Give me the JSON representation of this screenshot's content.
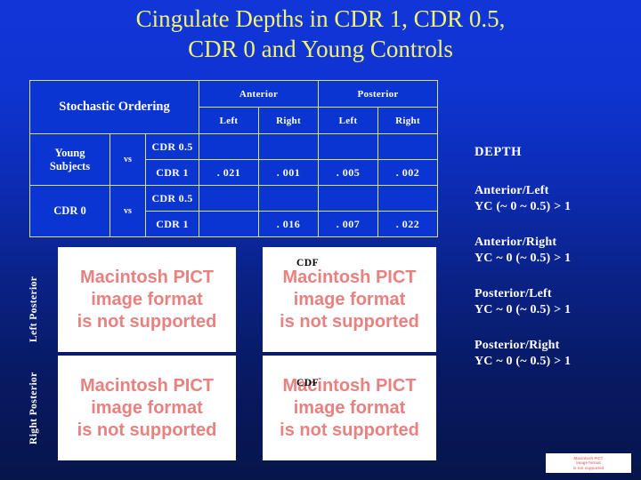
{
  "slide": {
    "title": "Cingulate Depths in CDR 1, CDR 0.5,\nCDR 0 and Young Controls",
    "title_color": "#F2F274",
    "background_top_color": "#1136D8",
    "background_bottom_color": "#06154A"
  },
  "table": {
    "corner_label": "Stochastic Ordering",
    "border_color": "#D8E27A",
    "cell_color": "#0B35D0",
    "group_headers": [
      "Anterior",
      "Posterior"
    ],
    "sub_headers": [
      "Left",
      "Right",
      "Left",
      "Right"
    ],
    "rows": [
      {
        "group_label": "Young\nSubjects",
        "vs_label": "vs",
        "comparisons": [
          {
            "label": "CDR 0.5",
            "values": [
              "",
              "",
              "",
              ""
            ]
          },
          {
            "label": "CDR 1",
            "values": [
              ". 021",
              ". 001",
              ". 005",
              ". 002"
            ]
          }
        ]
      },
      {
        "group_label": "CDR 0",
        "vs_label": "vs",
        "comparisons": [
          {
            "label": "CDR 0.5",
            "values": [
              "",
              "",
              "",
              ""
            ]
          },
          {
            "label": "CDR 1",
            "values": [
              "",
              ". 016",
              ". 007",
              ". 022"
            ]
          }
        ]
      }
    ]
  },
  "side_labels": {
    "left_posterior": "Left Posterior",
    "right_posterior": "Right Posterior"
  },
  "figures": {
    "placeholder_text": "Macintosh PICT\nimage format\nis not supported",
    "placeholder_text_color": "#E8817F",
    "cdf_label_top": "CDF",
    "cdf_label_bottom": "CDF"
  },
  "annotations": {
    "heading": "DEPTH",
    "groups": [
      {
        "title": "Anterior/Left",
        "detail": "YC (~ 0 ~ 0.5) > 1"
      },
      {
        "title": "Anterior/Right",
        "detail": "YC ~ 0 (~ 0.5) > 1"
      },
      {
        "title": "Posterior/Left",
        "detail": "YC ~ 0 (~ 0.5) > 1"
      },
      {
        "title": "Posterior/Right",
        "detail": "YC ~ 0 (~ 0.5) > 1"
      }
    ]
  }
}
